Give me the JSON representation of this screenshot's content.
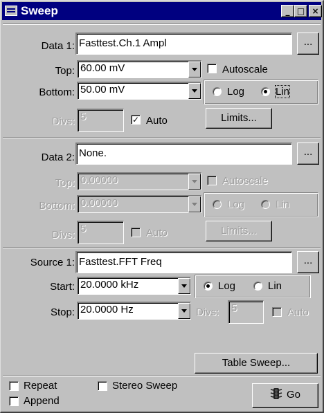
{
  "window": {
    "title": "Sweep",
    "controls": {
      "minimize": "_",
      "maximize": "□",
      "close": "×"
    }
  },
  "data1": {
    "label": "Data 1:",
    "value": "Fasttest.Ch.1 Ampl",
    "browse": "...",
    "top_label": "Top:",
    "top_value": "60.00  mV",
    "bottom_label": "Bottom:",
    "bottom_value": "50.00  mV",
    "autoscale_label": "Autoscale",
    "autoscale_checked": false,
    "log_label": "Log",
    "lin_label": "Lin",
    "scale_selected": "Lin",
    "divs_label": "Divs:",
    "divs_value": "5",
    "auto_label": "Auto",
    "auto_checked": true,
    "auto_mark": "✓",
    "limits_label": "Limits..."
  },
  "data2": {
    "label": "Data 2:",
    "value": "None.",
    "browse": "...",
    "top_label": "Top:",
    "top_value": "0.00000",
    "bottom_label": "Bottom:",
    "bottom_value": "0.00000",
    "autoscale_label": "Autoscale",
    "log_label": "Log",
    "lin_label": "Lin",
    "divs_label": "Divs:",
    "divs_value": "5",
    "auto_label": "Auto",
    "limits_label": "Limits..."
  },
  "source1": {
    "label": "Source 1:",
    "value": "Fasttest.FFT Freq",
    "browse": "...",
    "start_label": "Start:",
    "start_value": "20.0000 kHz",
    "stop_label": "Stop:",
    "stop_value": "20.0000  Hz",
    "log_label": "Log",
    "lin_label": "Lin",
    "scale_selected": "Log",
    "divs_label": "Divs:",
    "divs_value": "5",
    "auto_label": "Auto",
    "table_sweep_label": "Table Sweep..."
  },
  "footer": {
    "repeat_label": "Repeat",
    "stereo_label": "Stereo Sweep",
    "append_label": "Append",
    "go_label": "Go"
  },
  "colors": {
    "title_bar": "#000080",
    "face": "#c0c0c0",
    "disabled_text": "#a0a0a0"
  }
}
